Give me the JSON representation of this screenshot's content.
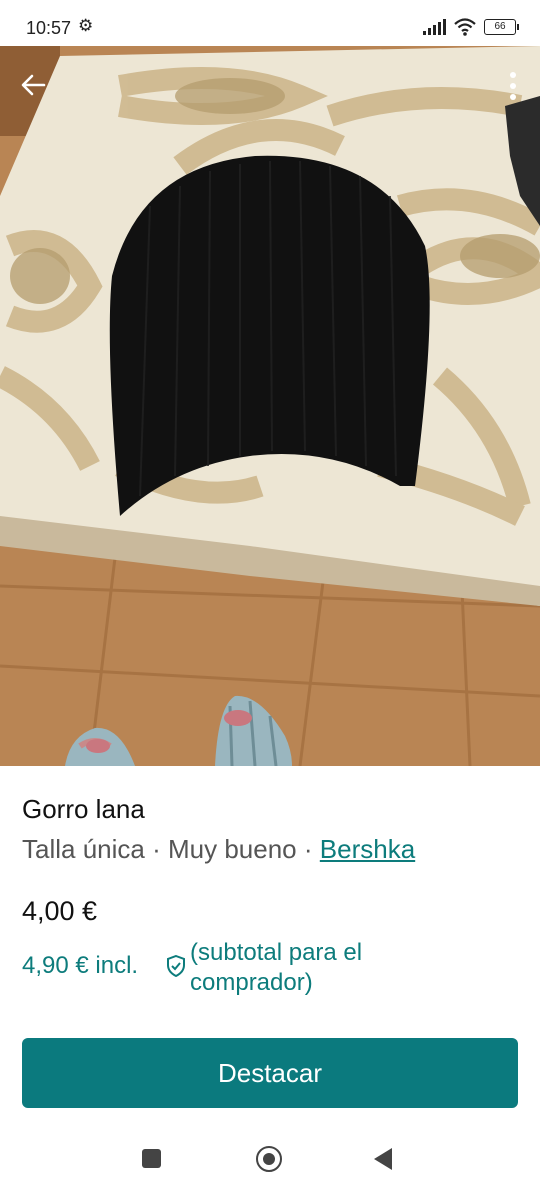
{
  "status_bar": {
    "time": "10:57",
    "battery": "66"
  },
  "item": {
    "title": "Gorro lana",
    "size": "Talla única",
    "separator": "·",
    "condition": "Muy bueno",
    "brand": "Bershka",
    "price": "4,00 €",
    "buyer_price": "4,90 € incl.",
    "buyer_note": "(subtotal para el comprador)"
  },
  "actions": {
    "feature_label": "Destacar"
  },
  "colors": {
    "accent": "#0b7a7e",
    "text_primary": "#111111",
    "text_secondary": "#555555"
  }
}
